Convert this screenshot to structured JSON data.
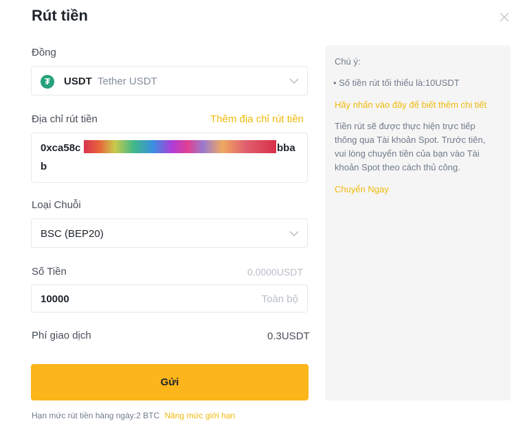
{
  "header": {
    "title": "Rút tiền",
    "close_icon": "close-icon"
  },
  "coin": {
    "label": "Đồng",
    "icon_symbol": "₮",
    "code": "USDT",
    "name": "Tether USDT"
  },
  "address": {
    "label": "Địa chỉ rút tiền",
    "add_link": "Thêm địa chỉ rút tiền",
    "line1_prefix": "0xca58c",
    "line1_suffix": "bba",
    "line2": "b"
  },
  "chain": {
    "label": "Loại Chuỗi",
    "value": "BSC (BEP20)"
  },
  "amount": {
    "label": "Số Tiền",
    "balance": "0.0000USDT",
    "value": "10000",
    "all_button": "Toàn bộ"
  },
  "fee": {
    "label": "Phí giao dịch",
    "value": "0.3USDT"
  },
  "submit_label": "Gửi",
  "limit": {
    "text": "Hạn mức rút tiền hàng ngày:2 BTC",
    "link": "Nâng mức giới hạn"
  },
  "notes": {
    "title": "Chú ý:",
    "bullet": "• Số tiền rút tối thiểu là:10USDT",
    "learn_more": "Hãy nhấn vào đây để biết thêm chi tiết",
    "description_lines": [
      "Tiền rút sẽ được thực hiện trực tiếp",
      "thông qua Tài khoản Spot. Trước tiên,",
      "vui lòng chuyển tiền của bạn vào Tài",
      "khoản Spot theo cách thủ công."
    ],
    "transfer_link": "Chuyển Ngay"
  },
  "colors": {
    "accent": "#f0b90b",
    "button": "#fcb51a",
    "coin_icon": "#26a17b"
  }
}
